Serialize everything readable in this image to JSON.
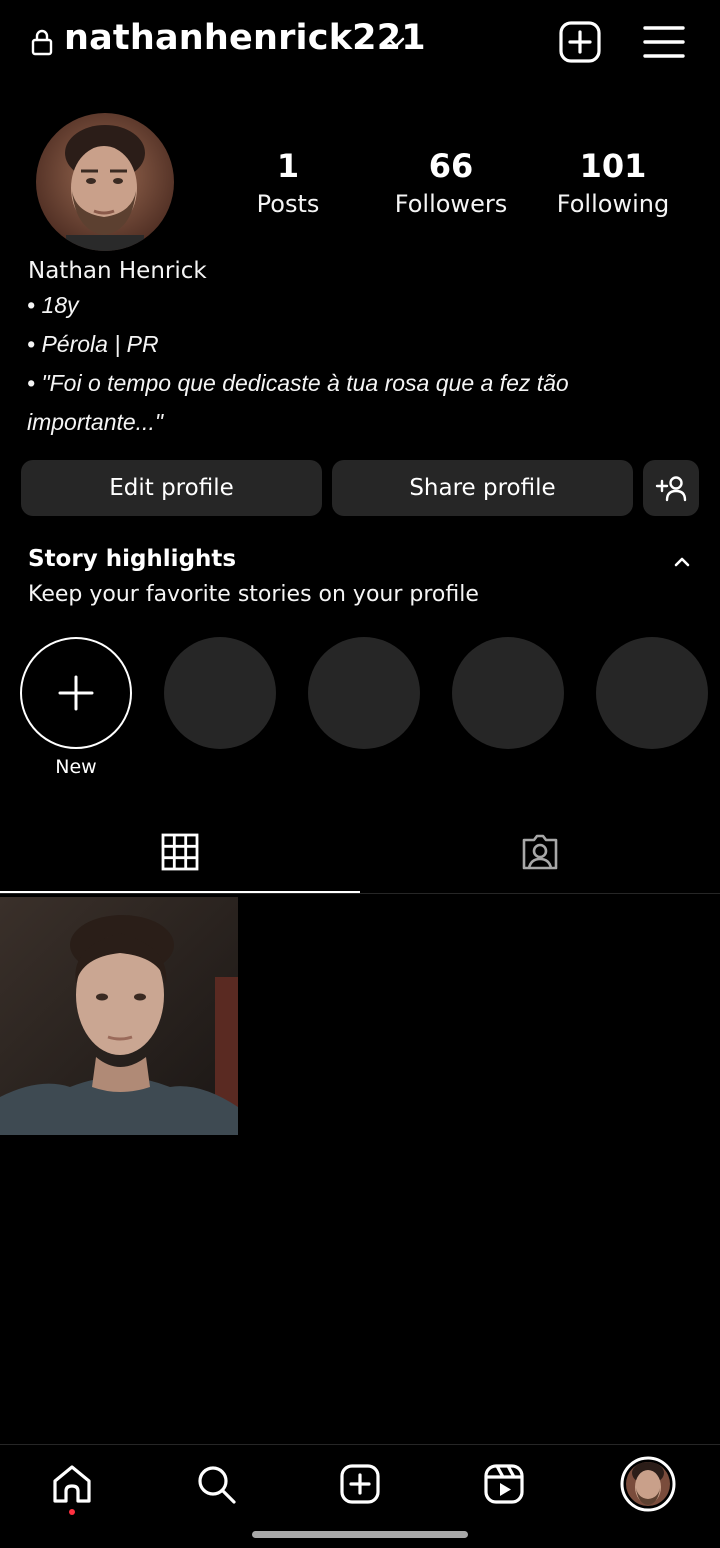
{
  "header": {
    "username": "nathanhenrick221",
    "icons": {
      "lock": "lock-icon",
      "dropdown": "chevron-down-icon",
      "create": "plus-square-icon",
      "menu": "hamburger-menu-icon"
    }
  },
  "profile": {
    "stats": [
      {
        "value": "1",
        "label": "Posts"
      },
      {
        "value": "66",
        "label": "Followers"
      },
      {
        "value": "101",
        "label": "Following"
      }
    ],
    "full_name": "Nathan Henrick",
    "bio_lines": [
      "• 18y",
      "• Pérola | PR",
      "• \"Foi o tempo que dedicaste à tua rosa que a fez tão",
      "importante...\""
    ]
  },
  "actions": {
    "edit_label": "Edit profile",
    "share_label": "Share profile",
    "suggest_icon": "add-person-icon"
  },
  "highlights": {
    "title": "Story highlights",
    "subtitle": "Keep your favorite stories on your profile",
    "new_label": "New",
    "empty_slots": 4
  },
  "tabs": {
    "items": [
      "posts-grid-icon",
      "tagged-icon"
    ],
    "active": "posts-grid-icon"
  },
  "bottom_nav": {
    "items": [
      "home-icon",
      "search-icon",
      "create-icon",
      "reels-icon",
      "profile-avatar"
    ],
    "active": "profile-avatar",
    "notification_dot": true
  },
  "colors": {
    "background": "#000000",
    "surface": "#262626",
    "text": "#f5f5f5",
    "notification": "#ff3040"
  }
}
